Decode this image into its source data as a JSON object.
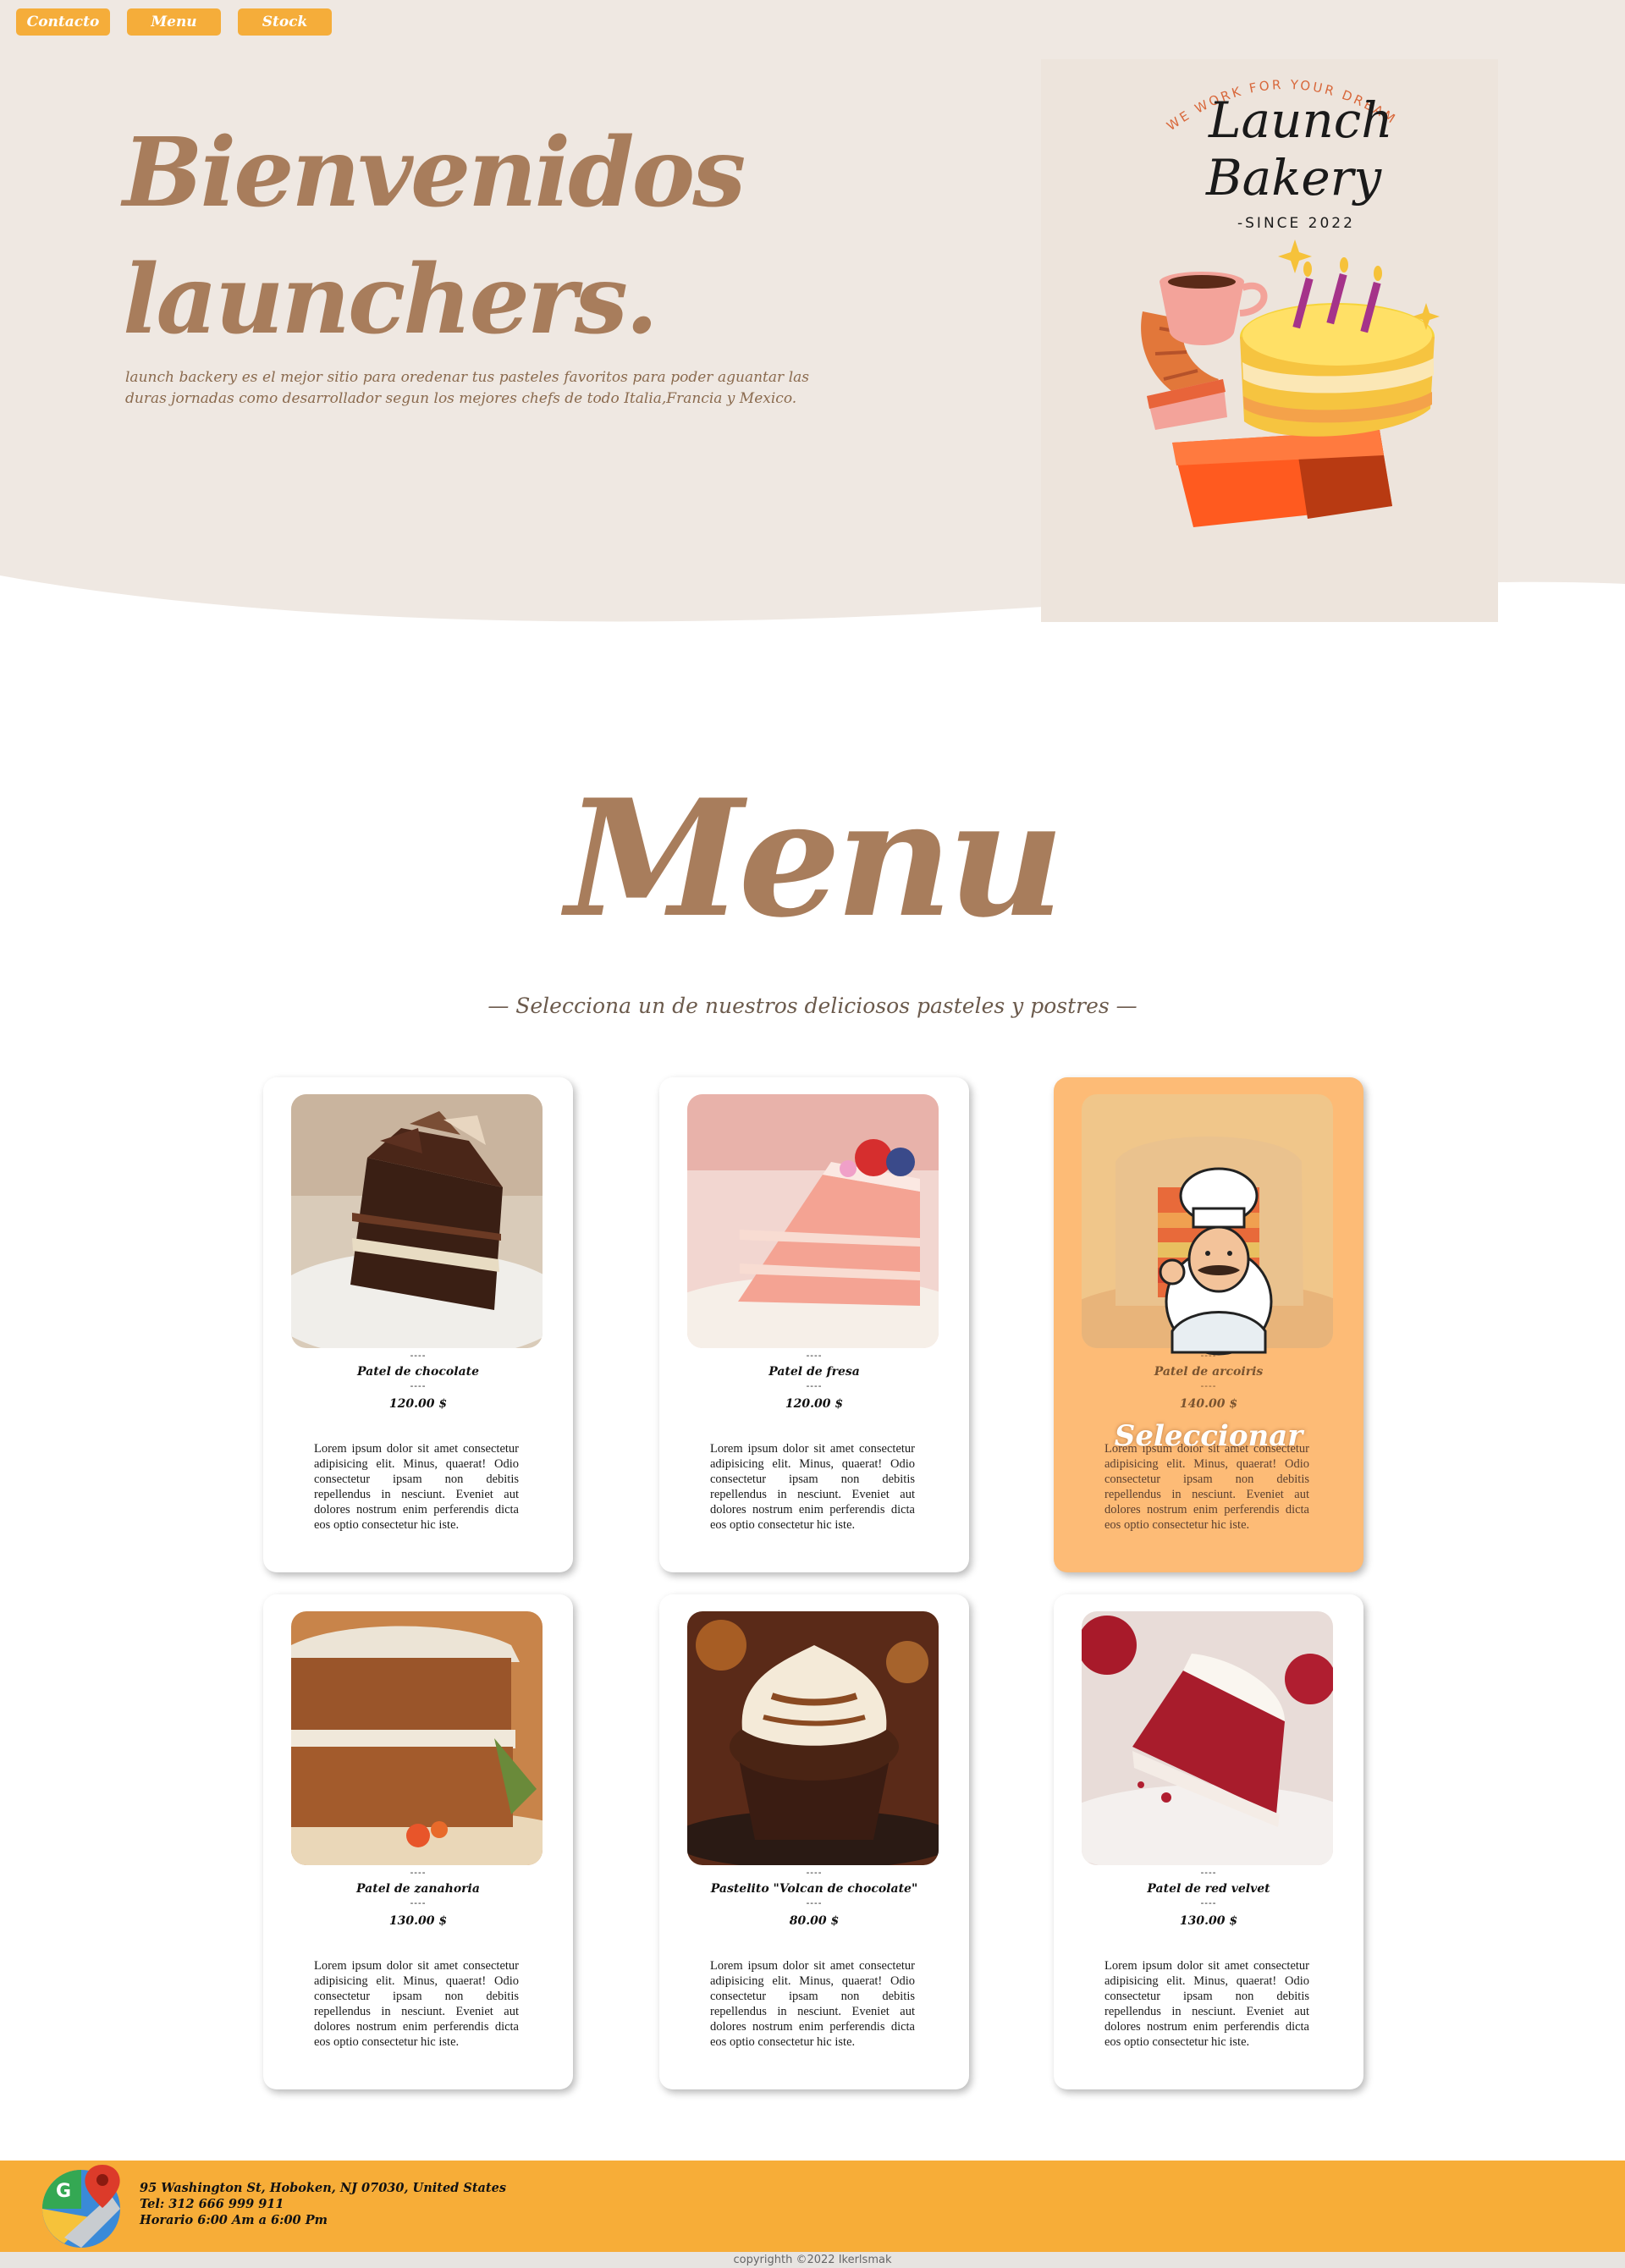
{
  "nav": {
    "items": [
      "Contacto",
      "Menu",
      "Stock"
    ]
  },
  "hero": {
    "title_line1": "Bienvenidos",
    "title_line2": "launchers.",
    "description": "launch backery es el mejor sitio para oredenar tus pasteles favoritos para poder aguantar las duras jornadas como desarrollador segun los mejores chefs de todo Italia,Francia y Mexico."
  },
  "logo": {
    "arc_text": "WE WORK FOR YOUR DREAMS",
    "name_line1": "Launch",
    "name_line2": "Bakery",
    "since": "-SINCE 2022"
  },
  "menu": {
    "title": "Menu",
    "subtitle": "— Selecciona un de nuestros deliciosos pasteles y postres —",
    "select_label": "Seleccionar",
    "dash": "----",
    "cards": [
      {
        "name": "Patel de chocolate",
        "price": "120.00 $",
        "description": "Lorem ipsum dolor sit amet consectetur adipisicing elit. Minus, quaerat! Odio consectetur ipsam non debitis repellendus in nesciunt. Eveniet aut dolores nostrum enim perferendis dicta eos optio consectetur hic iste.",
        "image": "chocolate-cake"
      },
      {
        "name": "Patel de fresa",
        "price": "120.00 $",
        "description": "Lorem ipsum dolor sit amet consectetur adipisicing elit. Minus, quaerat! Odio consectetur ipsam non debitis repellendus in nesciunt. Eveniet aut dolores nostrum enim perferendis dicta eos optio consectetur hic iste.",
        "image": "strawberry-cake"
      },
      {
        "name": "Patel de arcoiris",
        "price": "140.00 $",
        "description": "Lorem ipsum dolor sit amet consectetur adipisicing elit. Minus, quaerat! Odio consectetur ipsam non debitis repellendus in nesciunt. Eveniet aut dolores nostrum enim perferendis dicta eos optio consectetur hic iste.",
        "image": "rainbow-cake"
      },
      {
        "name": "Patel de zanahoria",
        "price": "130.00 $",
        "description": "Lorem ipsum dolor sit amet consectetur adipisicing elit. Minus, quaerat! Odio consectetur ipsam non debitis repellendus in nesciunt. Eveniet aut dolores nostrum enim perferendis dicta eos optio consectetur hic iste.",
        "image": "carrot-cake"
      },
      {
        "name": "Pastelito \"Volcan de chocolate\"",
        "price": "80.00 $",
        "description": "Lorem ipsum dolor sit amet consectetur adipisicing elit. Minus, quaerat! Odio consectetur ipsam non debitis repellendus in nesciunt. Eveniet aut dolores nostrum enim perferendis dicta eos optio consectetur hic iste.",
        "image": "lava-cupcake"
      },
      {
        "name": "Patel de red velvet",
        "price": "130.00 $",
        "description": "Lorem ipsum dolor sit amet consectetur adipisicing elit. Minus, quaerat! Odio consectetur ipsam non debitis repellendus in nesciunt. Eveniet aut dolores nostrum enim perferendis dicta eos optio consectetur hic iste.",
        "image": "red-velvet-cake"
      }
    ]
  },
  "footer": {
    "address": "95 Washington St, Hoboken, NJ 07030, United States",
    "phone": "Tel: 312 666 999 911",
    "hours": "Horario 6:00 Am a 6:00 Pm",
    "copyright": "copyrighth ©2022 Ikerlsmak"
  },
  "colors": {
    "accent": "#f5ad3a",
    "brown": "#a87d5c",
    "hero_bg": "#efe8e2",
    "active_card": "#fdbb76"
  }
}
